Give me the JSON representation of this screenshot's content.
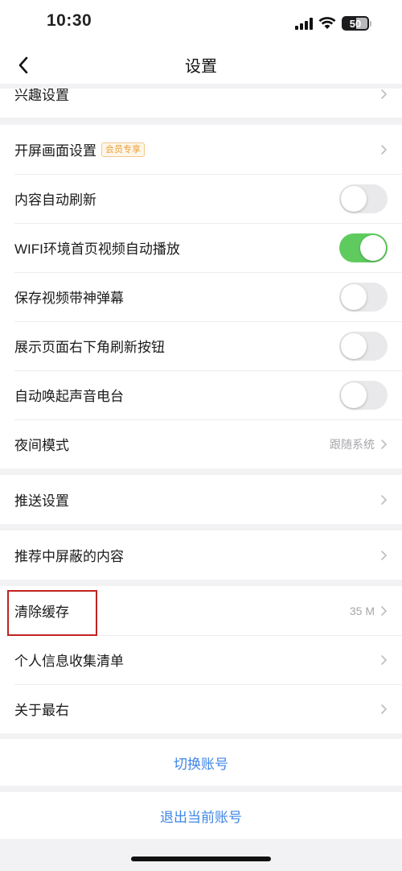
{
  "status_bar": {
    "time": "10:30",
    "battery": "50"
  },
  "nav": {
    "title": "设置"
  },
  "group_interest": {
    "label": "兴趣设置"
  },
  "group_display": {
    "splash": {
      "label": "开屏画面设置",
      "badge": "会员专享"
    },
    "auto_refresh": {
      "label": "内容自动刷新",
      "on": false
    },
    "wifi_autoplay": {
      "label": "WIFI环境首页视频自动播放",
      "on": true
    },
    "save_danmaku": {
      "label": "保存视频带神弹幕",
      "on": false
    },
    "refresh_button": {
      "label": "展示页面右下角刷新按钮",
      "on": false
    },
    "radio": {
      "label": "自动唤起声音电台",
      "on": false
    },
    "night_mode": {
      "label": "夜间模式",
      "value": "跟随系统"
    }
  },
  "group_push": {
    "label": "推送设置"
  },
  "group_blocked": {
    "label": "推荐中屏蔽的内容"
  },
  "group_misc": {
    "clear_cache": {
      "label": "清除缓存",
      "value": "35 M"
    },
    "privacy_list": {
      "label": "个人信息收集清单"
    },
    "about": {
      "label": "关于最右"
    }
  },
  "actions": {
    "switch_account": "切换账号",
    "logout": "退出当前账号"
  },
  "colors": {
    "accent": "#3f86e6",
    "toggle_on": "#5fcb5f",
    "highlight": "#c0231f"
  }
}
